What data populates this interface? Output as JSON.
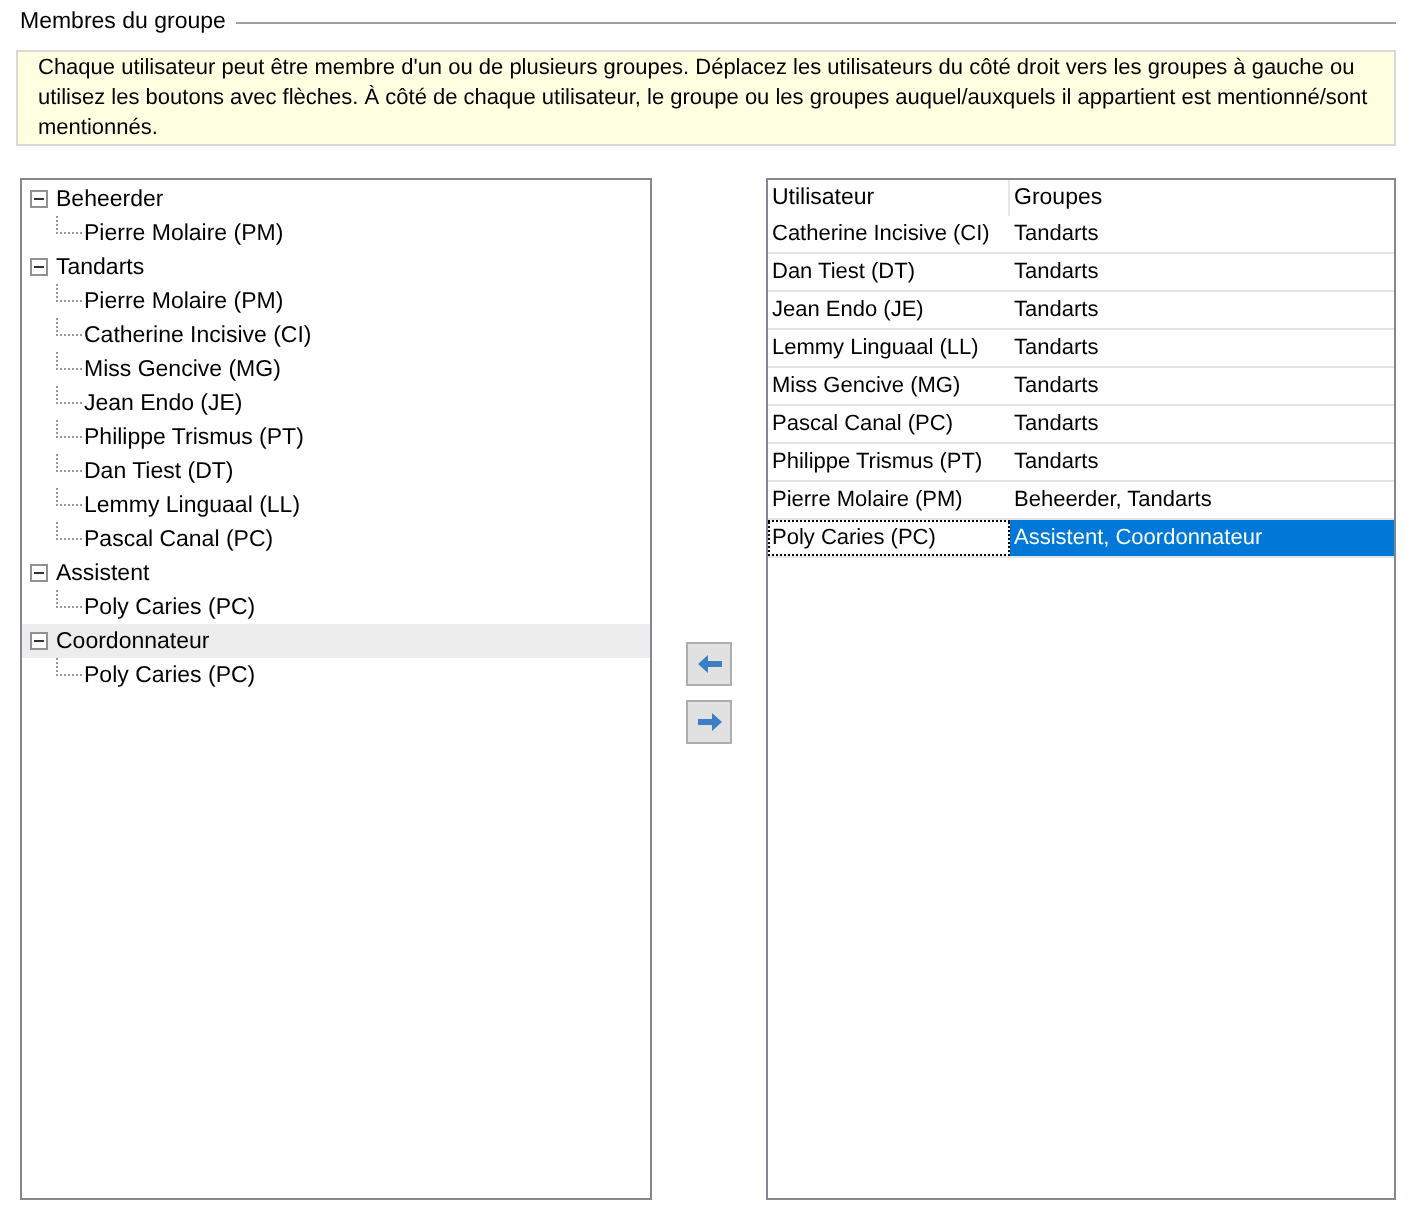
{
  "group_box": {
    "title": "Membres du groupe"
  },
  "info": "Chaque utilisateur peut être membre d'un ou de plusieurs groupes. Déplacez les utilisateurs du côté droit vers les groupes à gauche ou utilisez les boutons avec flèches. À côté de chaque utilisateur, le groupe ou les groupes auquel/auxquels il appartient est mentionné/sont mentionnés.",
  "tree": [
    {
      "label": "Beheerder",
      "expanded": true,
      "selected": false,
      "children": [
        {
          "label": "Pierre Molaire (PM)"
        }
      ]
    },
    {
      "label": "Tandarts",
      "expanded": true,
      "selected": false,
      "children": [
        {
          "label": "Pierre Molaire (PM)"
        },
        {
          "label": "Catherine Incisive (CI)"
        },
        {
          "label": "Miss Gencive (MG)"
        },
        {
          "label": "Jean Endo (JE)"
        },
        {
          "label": "Philippe Trismus (PT)"
        },
        {
          "label": "Dan Tiest (DT)"
        },
        {
          "label": "Lemmy Linguaal (LL)"
        },
        {
          "label": "Pascal Canal (PC)"
        }
      ]
    },
    {
      "label": "Assistent",
      "expanded": true,
      "selected": false,
      "children": [
        {
          "label": "Poly Caries (PC)"
        }
      ]
    },
    {
      "label": "Coordonnateur",
      "expanded": true,
      "selected": true,
      "children": [
        {
          "label": "Poly Caries (PC)"
        }
      ]
    }
  ],
  "table": {
    "columns": [
      "Utilisateur",
      "Groupes"
    ],
    "rows": [
      {
        "user": "Catherine Incisive (CI)",
        "groups": "Tandarts",
        "selected": false
      },
      {
        "user": "Dan Tiest (DT)",
        "groups": "Tandarts",
        "selected": false
      },
      {
        "user": "Jean Endo (JE)",
        "groups": "Tandarts",
        "selected": false
      },
      {
        "user": "Lemmy Linguaal (LL)",
        "groups": "Tandarts",
        "selected": false
      },
      {
        "user": "Miss Gencive (MG)",
        "groups": "Tandarts",
        "selected": false
      },
      {
        "user": "Pascal Canal (PC)",
        "groups": "Tandarts",
        "selected": false
      },
      {
        "user": "Philippe Trismus (PT)",
        "groups": "Tandarts",
        "selected": false
      },
      {
        "user": "Pierre Molaire (PM)",
        "groups": "Beheerder, Tandarts",
        "selected": false
      },
      {
        "user": "Poly Caries (PC)",
        "groups": "Assistent, Coordonnateur",
        "selected": true
      }
    ]
  }
}
